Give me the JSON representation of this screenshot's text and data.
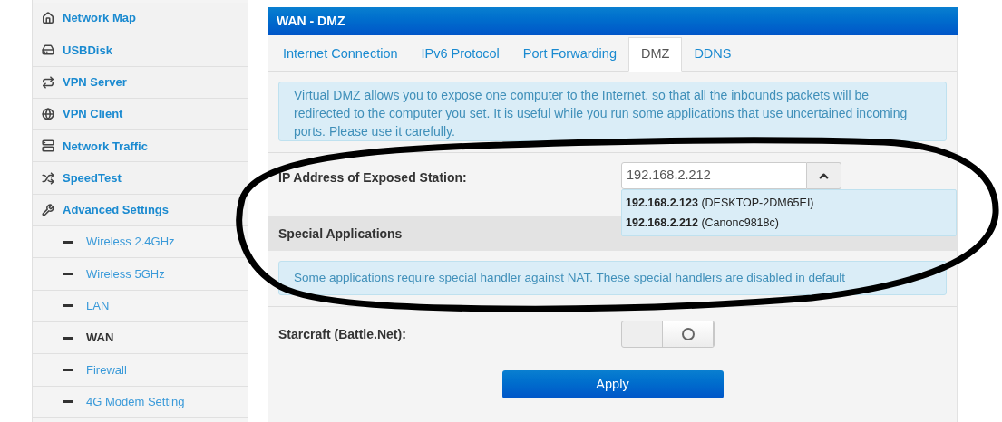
{
  "sidebar": {
    "items": [
      {
        "label": "Network Map",
        "selected": false
      },
      {
        "label": "USBDisk",
        "selected": false
      },
      {
        "label": "VPN Server",
        "selected": false
      },
      {
        "label": "VPN Client",
        "selected": false
      },
      {
        "label": "Network Traffic",
        "selected": false
      },
      {
        "label": "SpeedTest",
        "selected": false
      },
      {
        "label": "Advanced Settings",
        "selected": false,
        "children": [
          {
            "label": "Wireless 2.4GHz",
            "selected": false
          },
          {
            "label": "Wireless 5GHz",
            "selected": false
          },
          {
            "label": "LAN",
            "selected": false
          },
          {
            "label": "WAN",
            "selected": true
          },
          {
            "label": "Firewall",
            "selected": false
          },
          {
            "label": "4G Modem Setting",
            "selected": false
          }
        ]
      }
    ]
  },
  "panel": {
    "title": "WAN - DMZ",
    "tabs": [
      {
        "label": "Internet Connection",
        "selected": false
      },
      {
        "label": "IPv6 Protocol",
        "selected": false
      },
      {
        "label": "Port Forwarding",
        "selected": false
      },
      {
        "label": "DMZ",
        "selected": true
      },
      {
        "label": "DDNS",
        "selected": false
      }
    ],
    "dmz_info": "Virtual DMZ allows you to expose one computer to the Internet, so that all the inbounds packets will be redirected to the computer you set. It is useful while you run some applications that use uncertained incoming ports. Please use it carefully.",
    "exposed_station": {
      "label": "IP Address of Exposed Station:",
      "value": "192.168.2.212",
      "suggestions": [
        "**192.168.2.123** (DESKTOP-2DM65EI)",
        "**192.168.2.212** (Canonc9818c)"
      ]
    },
    "special_title": "Special Applications",
    "special_info": "Some applications require special handler against NAT. These special handlers are disabled in default",
    "starcraft": {
      "label": "Starcraft (Battle.Net):",
      "on": false
    },
    "apply": "Apply"
  }
}
